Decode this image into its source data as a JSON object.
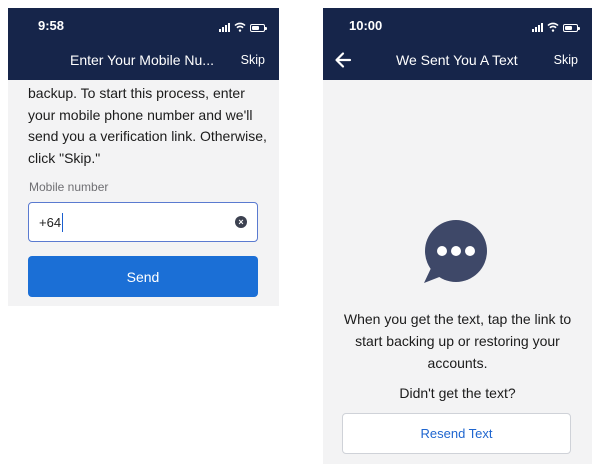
{
  "left_screen": {
    "status_time": "9:58",
    "battery_level": 0.6,
    "nav_title": "Enter Your Mobile Nu...",
    "skip_label": "Skip",
    "body_text": "backup. To start this process, enter your mobile phone number and we'll send you a verification link. Otherwise, click \"Skip.\"",
    "field_label": "Mobile number",
    "input_value": "+64",
    "send_label": "Send"
  },
  "right_screen": {
    "status_time": "10:00",
    "battery_level": 0.6,
    "nav_title": "We Sent You A Text",
    "skip_label": "Skip",
    "message_text": "When you get the text, tap the link to start backing up or restoring your accounts.",
    "didnt_get_text": "Didn't get the text?",
    "resend_label": "Resend Text"
  },
  "icons": {
    "back": "back-arrow-icon",
    "clear": "clear-input-icon",
    "chat": "chat-bubble-icon",
    "signal": "signal-icon",
    "wifi": "wifi-icon",
    "battery": "battery-icon"
  },
  "colors": {
    "header_background": "#16254a",
    "primary_button": "#1b6fd6",
    "link_text": "#1f66cf",
    "screen_background": "#f3f3f4",
    "chat_icon": "#3e4868",
    "input_focus_border": "#5a7ad0"
  }
}
